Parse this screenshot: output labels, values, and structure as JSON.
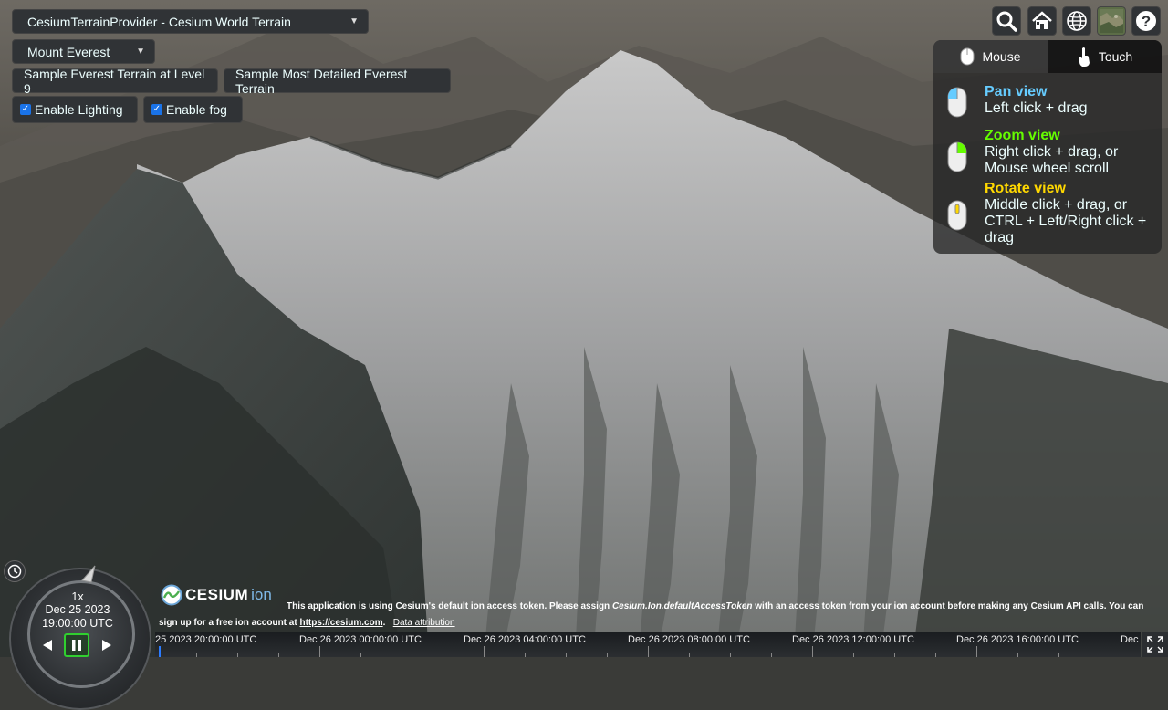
{
  "toolbar": {
    "terrain_select": "CesiumTerrainProvider - Cesium World Terrain",
    "location_select": "Mount Everest",
    "sample_level9_button": "Sample Everest Terrain at Level 9",
    "sample_detailed_button": "Sample Most Detailed Everest Terrain",
    "lighting_label": "Enable Lighting",
    "lighting_checked": true,
    "fog_label": "Enable fog",
    "fog_checked": true
  },
  "top_right_icons": [
    "search-icon",
    "home-icon",
    "globe-icon",
    "imagery-layer-icon",
    "help-icon"
  ],
  "nav_help": {
    "tabs": [
      "Mouse",
      "Touch"
    ],
    "active_tab": "Mouse",
    "items": [
      {
        "title": "Pan view",
        "desc": "Left click + drag",
        "color": "#66ccff"
      },
      {
        "title": "Zoom view",
        "desc": "Right click + drag, or Mouse wheel scroll",
        "desc_lines": [
          "Right click + drag, or",
          "Mouse wheel scroll"
        ],
        "color": "#65fd00"
      },
      {
        "title": "Rotate view",
        "desc": "Middle click + drag, or CTRL + Left/Right click + drag",
        "desc_lines": [
          "Middle click + drag, or",
          "CTRL + Left/Right click +",
          "drag"
        ],
        "color": "#ffd800"
      }
    ]
  },
  "animation": {
    "speed": "1x",
    "date": "Dec 25 2023",
    "time": "19:00:00 UTC"
  },
  "credits": {
    "logo_text": "CESIUM",
    "logo_suffix": "ion",
    "line1_pre": "This application is using Cesium's default ion access token. Please assign ",
    "line1_code": "Cesium.Ion.defaultAccessToken",
    "line1_post": " with an access token from your ion account before making any Cesium API calls. You can",
    "line2_pre": "sign up for a free ion account at ",
    "line2_link": "https://cesium.com",
    "line2_post": ".",
    "data_attribution": "Data attribution"
  },
  "timeline": {
    "labels": [
      "25 2023 20:00:00 UTC",
      "Dec 26 2023 00:00:00 UTC",
      "Dec 26 2023 04:00:00 UTC",
      "Dec 26 2023 08:00:00 UTC",
      "Dec 26 2023 12:00:00 UTC",
      "Dec 26 2023 16:00:00 UTC",
      "Dec"
    ]
  },
  "colors": {
    "button_bg": "#303336",
    "pan": "#66ccff",
    "zoom": "#65fd00",
    "rotate": "#ffd800",
    "play_highlight": "#30d02f"
  }
}
